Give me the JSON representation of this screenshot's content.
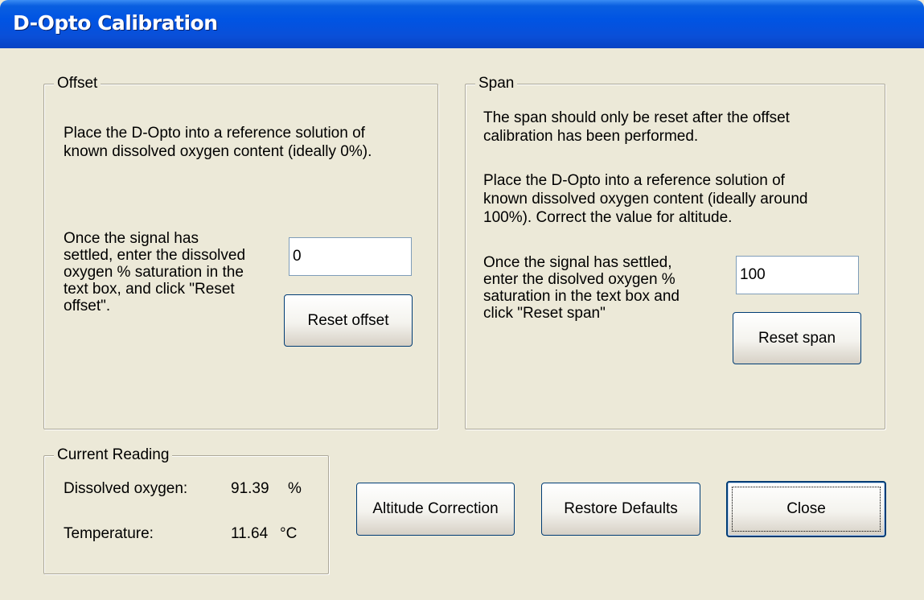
{
  "window": {
    "title": "D-Opto Calibration"
  },
  "offset": {
    "legend": "Offset",
    "intro_line1": "Place the D-Opto into a reference solution of",
    "intro_line2": "known dissolved oxygen content (ideally 0%).",
    "instr_line1": "Once the signal has",
    "instr_line2": "settled, enter the dissolved",
    "instr_line3": "oxygen % saturation in the",
    "instr_line4": "text box, and click \"Reset",
    "instr_line5": "offset\".",
    "input_value": "0",
    "button_label": "Reset offset"
  },
  "span": {
    "legend": "Span",
    "note_line1": "The span should only be reset after the offset",
    "note_line2": "calibration has been performed.",
    "intro_line1": "Place the D-Opto into a reference solution of",
    "intro_line2": "known dissolved oxygen content (ideally around",
    "intro_line3": "100%). Correct the value for altitude.",
    "instr_line1": "Once the signal has settled,",
    "instr_line2": "enter the disolved oxygen %",
    "instr_line3": "saturation in the text box and",
    "instr_line4": "click \"Reset span\"",
    "input_value": "100",
    "button_label": "Reset span"
  },
  "reading": {
    "legend": "Current Reading",
    "do_label": "Dissolved oxygen:",
    "do_value": "91.39",
    "do_unit": "%",
    "temp_label": "Temperature:",
    "temp_value": "11.64",
    "temp_unit": "°C"
  },
  "buttons": {
    "altitude": "Altitude Correction",
    "restore": "Restore Defaults",
    "close": "Close"
  }
}
